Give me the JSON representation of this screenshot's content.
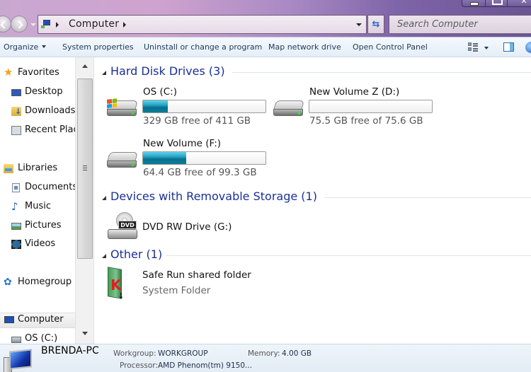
{
  "window": {
    "address": {
      "breadcrumb": [
        "Computer"
      ]
    },
    "search": {
      "placeholder": "Search Computer"
    },
    "controls": {
      "close": "✕"
    }
  },
  "toolbar": {
    "items": [
      {
        "label": "Organize",
        "has_dropdown": true
      },
      {
        "label": "System properties"
      },
      {
        "label": "Uninstall or change a program"
      },
      {
        "label": "Map network drive"
      },
      {
        "label": "Open Control Panel"
      }
    ],
    "icons": [
      "views-icon",
      "preview-pane-icon",
      "help-icon"
    ]
  },
  "nav": {
    "items": [
      {
        "label": "Favorites",
        "icon": "star-icon"
      },
      {
        "label": "Desktop",
        "icon": "desktop-icon"
      },
      {
        "label": "Downloads",
        "icon": "downloads-icon"
      },
      {
        "label": "Recent Places",
        "icon": "recent-places-icon"
      },
      {
        "label": "Libraries",
        "icon": "libraries-icon"
      },
      {
        "label": "Documents",
        "icon": "documents-icon"
      },
      {
        "label": "Music",
        "icon": "music-icon"
      },
      {
        "label": "Pictures",
        "icon": "pictures-icon"
      },
      {
        "label": "Videos",
        "icon": "videos-icon"
      },
      {
        "label": "Homegroup",
        "icon": "homegroup-icon"
      },
      {
        "label": "Computer",
        "icon": "computer-icon",
        "selected": true
      },
      {
        "label": "OS (C:)",
        "icon": "drive-icon"
      }
    ]
  },
  "groups": {
    "hard_disks": {
      "title": "Hard Disk Drives (3)",
      "drives": [
        {
          "name": "OS (C:)",
          "free_text": "329 GB free of 411 GB",
          "used_fraction": 0.2,
          "system": true
        },
        {
          "name": "New Volume  Z (D:)",
          "free_text": "75.5 GB free of 75.6 GB",
          "used_fraction": 0.001
        },
        {
          "name": "New Volume (F:)",
          "free_text": "64.4 GB free of 99.3 GB",
          "used_fraction": 0.35
        }
      ]
    },
    "removable": {
      "title": "Devices with Removable Storage (1)",
      "devices": [
        {
          "name": "DVD RW Drive (G:)",
          "icon_label": "DVD"
        }
      ]
    },
    "other": {
      "title": "Other (1)",
      "items": [
        {
          "name": "Safe Run shared folder",
          "type": "System Folder"
        }
      ]
    }
  },
  "details": {
    "computer_name": "BRENDA-PC",
    "workgroup_label": "Workgroup:",
    "workgroup_value": "WORKGROUP",
    "memory_label": "Memory:",
    "memory_value": "4.00 GB",
    "processor_label": "Processor:",
    "processor_value": "AMD Phenom(tm) 9150..."
  }
}
